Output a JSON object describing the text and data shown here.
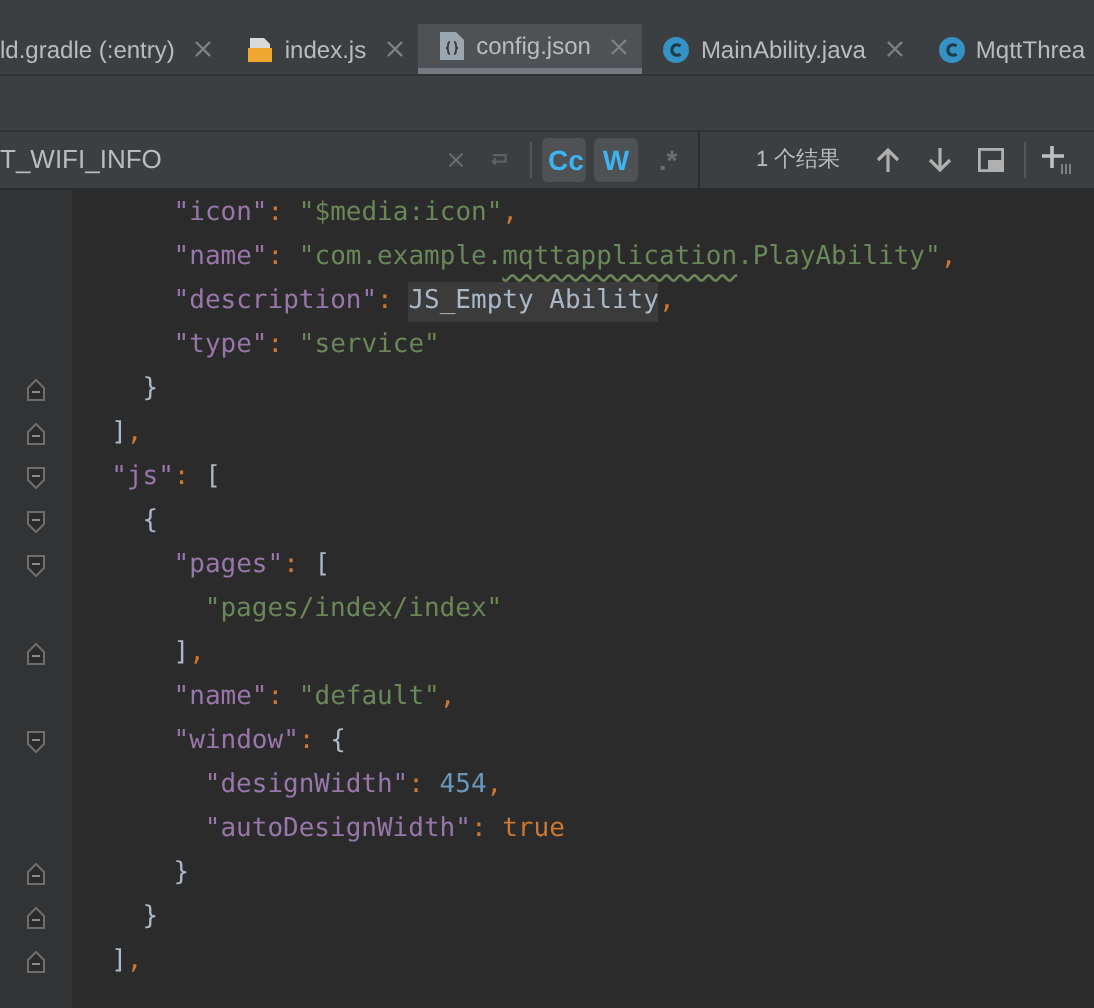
{
  "tabs": [
    {
      "label": "ld.gradle (:entry)",
      "kind": "plain",
      "selected": false
    },
    {
      "label": "index.js",
      "kind": "js",
      "selected": false
    },
    {
      "label": "config.json",
      "kind": "json",
      "selected": true
    },
    {
      "label": "MainAbility.java",
      "kind": "class",
      "selected": false
    },
    {
      "label": "MqttThrea",
      "kind": "class",
      "selected": false
    }
  ],
  "search": {
    "value": "T_WIFI_INFO",
    "options": [
      {
        "label": "Cc",
        "selected": true
      },
      {
        "label": "W",
        "selected": true
      },
      {
        "label": ".*",
        "selected": false
      }
    ],
    "result": "1 个结果"
  },
  "editor": {
    "lines": [
      {
        "tokens": [
          {
            "kind": "key",
            "text": "\"icon\""
          },
          {
            "kind": "punct",
            "text": ": "
          },
          {
            "kind": "str",
            "text": "\"$media:icon\""
          },
          {
            "kind": "punct",
            "text": ","
          }
        ]
      },
      {
        "tokens": [
          {
            "kind": "key",
            "text": "\"name\""
          },
          {
            "kind": "punct",
            "text": ": "
          },
          {
            "kind": "str",
            "text": "\"com.example."
          },
          {
            "kind": "typo",
            "text": "mqttapplication"
          },
          {
            "kind": "str",
            "text": ".PlayAbility\""
          },
          {
            "kind": "punct",
            "text": ","
          }
        ]
      },
      {
        "tokens": [
          {
            "kind": "key",
            "text": "\"description\""
          },
          {
            "kind": "punct",
            "text": ": "
          },
          {
            "kind": "ref",
            "text": "JS_Empty Ability"
          },
          {
            "kind": "punct",
            "text": ","
          }
        ]
      },
      {
        "tokens": [
          {
            "kind": "key",
            "text": "\"type\""
          },
          {
            "kind": "punct",
            "text": ": "
          },
          {
            "kind": "str",
            "text": "\"service\""
          }
        ]
      },
      {
        "tokens": [
          {
            "kind": "close",
            "text": "}"
          }
        ]
      },
      {
        "tokens": [
          {
            "kind": "close",
            "text": "]"
          },
          {
            "kind": "punct",
            "text": ","
          }
        ]
      },
      {
        "tokens": [
          {
            "kind": "key",
            "text": "\"js\""
          },
          {
            "kind": "punct",
            "text": ": "
          },
          {
            "kind": "open",
            "text": "["
          }
        ]
      },
      {
        "tokens": [
          {
            "kind": "open",
            "text": "{"
          }
        ]
      },
      {
        "tokens": [
          {
            "kind": "key",
            "text": "\"pages\""
          },
          {
            "kind": "punct",
            "text": ": "
          },
          {
            "kind": "open",
            "text": "["
          }
        ]
      },
      {
        "tokens": [
          {
            "kind": "str",
            "text": "\"pages/index/index\""
          }
        ]
      },
      {
        "tokens": [
          {
            "kind": "close",
            "text": "]"
          },
          {
            "kind": "punct",
            "text": ","
          }
        ]
      },
      {
        "tokens": [
          {
            "kind": "key",
            "text": "\"name\""
          },
          {
            "kind": "punct",
            "text": ": "
          },
          {
            "kind": "str",
            "text": "\"default\""
          },
          {
            "kind": "punct",
            "text": ","
          }
        ]
      },
      {
        "tokens": [
          {
            "kind": "key",
            "text": "\"window\""
          },
          {
            "kind": "punct",
            "text": ": "
          },
          {
            "kind": "open",
            "text": "{"
          }
        ]
      },
      {
        "tokens": [
          {
            "kind": "key",
            "text": "\"designWidth\""
          },
          {
            "kind": "punct",
            "text": ": "
          },
          {
            "kind": "num",
            "text": "454"
          },
          {
            "kind": "punct",
            "text": ","
          }
        ]
      },
      {
        "tokens": [
          {
            "kind": "key",
            "text": "\"autoDesignWidth\""
          },
          {
            "kind": "punct",
            "text": ": "
          },
          {
            "kind": "bool",
            "text": "true"
          }
        ]
      },
      {
        "tokens": [
          {
            "kind": "close",
            "text": "}"
          }
        ]
      },
      {
        "tokens": [
          {
            "kind": "close",
            "text": "}"
          }
        ]
      },
      {
        "tokens": [
          {
            "kind": "close",
            "text": "]"
          },
          {
            "kind": "punct",
            "text": ","
          }
        ]
      }
    ]
  }
}
